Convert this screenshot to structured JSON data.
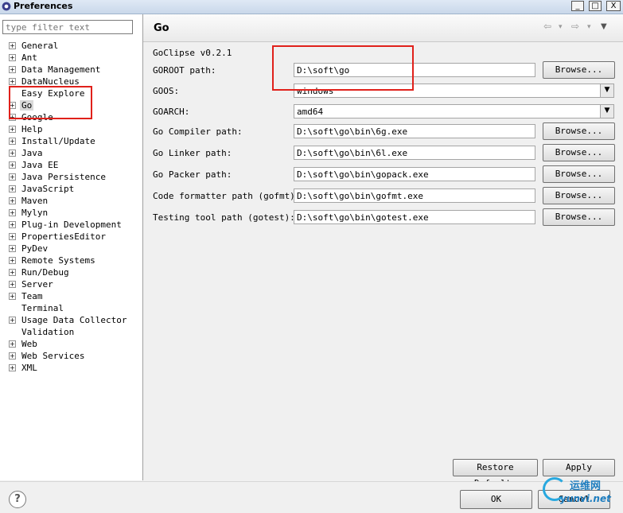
{
  "window": {
    "title": "Preferences",
    "minimize": "_",
    "maximize": "□",
    "close": "X"
  },
  "filter": {
    "placeholder": "type filter text",
    "value": ""
  },
  "tree": {
    "items": [
      {
        "label": "General",
        "expandable": true
      },
      {
        "label": "Ant",
        "expandable": true
      },
      {
        "label": "Data Management",
        "expandable": true
      },
      {
        "label": "DataNucleus",
        "expandable": true
      },
      {
        "label": "Easy Explore",
        "expandable": false
      },
      {
        "label": "Go",
        "expandable": true,
        "selected": true
      },
      {
        "label": "Google",
        "expandable": true
      },
      {
        "label": "Help",
        "expandable": true
      },
      {
        "label": "Install/Update",
        "expandable": true
      },
      {
        "label": "Java",
        "expandable": true
      },
      {
        "label": "Java EE",
        "expandable": true
      },
      {
        "label": "Java Persistence",
        "expandable": true
      },
      {
        "label": "JavaScript",
        "expandable": true
      },
      {
        "label": "Maven",
        "expandable": true
      },
      {
        "label": "Mylyn",
        "expandable": true
      },
      {
        "label": "Plug-in Development",
        "expandable": true
      },
      {
        "label": "PropertiesEditor",
        "expandable": true
      },
      {
        "label": "PyDev",
        "expandable": true
      },
      {
        "label": "Remote Systems",
        "expandable": true
      },
      {
        "label": "Run/Debug",
        "expandable": true
      },
      {
        "label": "Server",
        "expandable": true
      },
      {
        "label": "Team",
        "expandable": true
      },
      {
        "label": "Terminal",
        "expandable": false
      },
      {
        "label": "Usage Data Collector",
        "expandable": true
      },
      {
        "label": "Validation",
        "expandable": false
      },
      {
        "label": "Web",
        "expandable": true
      },
      {
        "label": "Web Services",
        "expandable": true
      },
      {
        "label": "XML",
        "expandable": true
      }
    ]
  },
  "page": {
    "title": "Go",
    "nav_back": "⇦",
    "nav_forward": "⇨",
    "nav_dropdown": "▾",
    "menu": "▼",
    "subtitle": "GoClipse v0.2.1",
    "goroot_label": "GOROOT path:",
    "goroot_value": "D:\\soft\\go",
    "goos_label": "GOOS:",
    "goos_value": "windows",
    "goarch_label": "GOARCH:",
    "goarch_value": "amd64",
    "compiler_label": "Go Compiler path:",
    "compiler_value": "D:\\soft\\go\\bin\\6g.exe",
    "linker_label": "Go Linker path:",
    "linker_value": "D:\\soft\\go\\bin\\6l.exe",
    "packer_label": "Go Packer path:",
    "packer_value": "D:\\soft\\go\\bin\\gopack.exe",
    "formatter_label": "Code formatter path (gofmt):",
    "formatter_value": "D:\\soft\\go\\bin\\gofmt.exe",
    "tester_label": "Testing tool path (gotest):",
    "tester_value": "D:\\soft\\go\\bin\\gotest.exe",
    "browse_label": "Browse...",
    "restore_defaults": "Restore Defaults",
    "apply": "Apply"
  },
  "footer": {
    "help": "?",
    "ok": "OK",
    "cancel": "Cancel"
  },
  "watermark": {
    "line1": "运维网",
    "line2": "yunvi.net"
  },
  "colors": {
    "highlight": "#e0211b",
    "watermark": "#1e7dbf"
  }
}
